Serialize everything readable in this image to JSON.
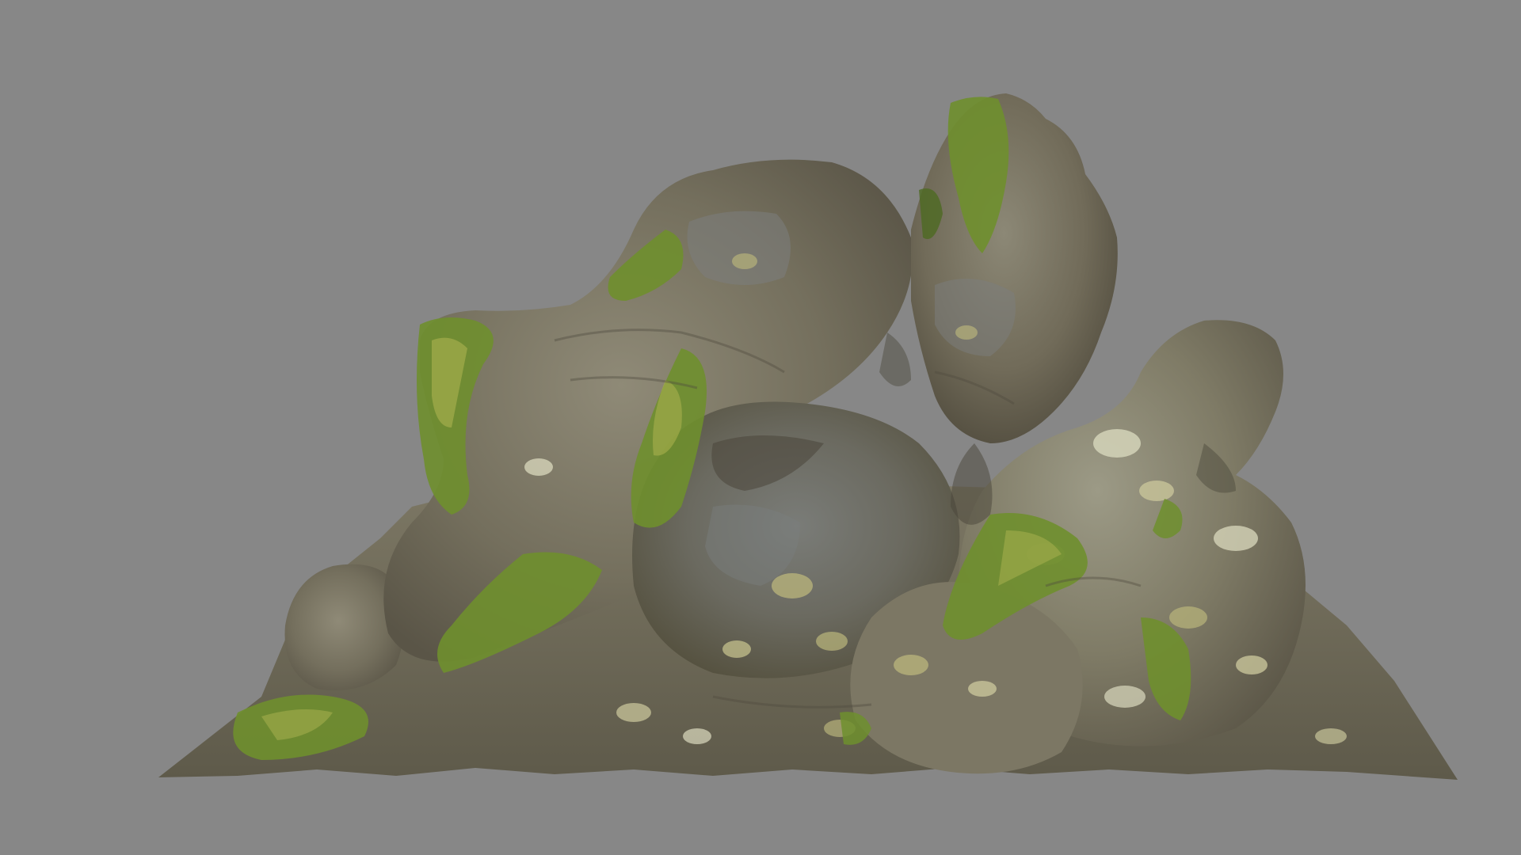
{
  "scene": {
    "subject": "rock-formation-icon",
    "colors": {
      "background": "#878787",
      "rock_light": "#8f8a76",
      "rock_mid": "#756f5c",
      "rock_dark": "#4f4b3f",
      "rock_grey": "#6d7070",
      "lichen": "#b6b27a",
      "lichen_pale": "#d4d3b8",
      "moss": "#6f8f2e",
      "moss_light": "#a4ad4c",
      "moss_dark": "#4d6a22"
    }
  }
}
